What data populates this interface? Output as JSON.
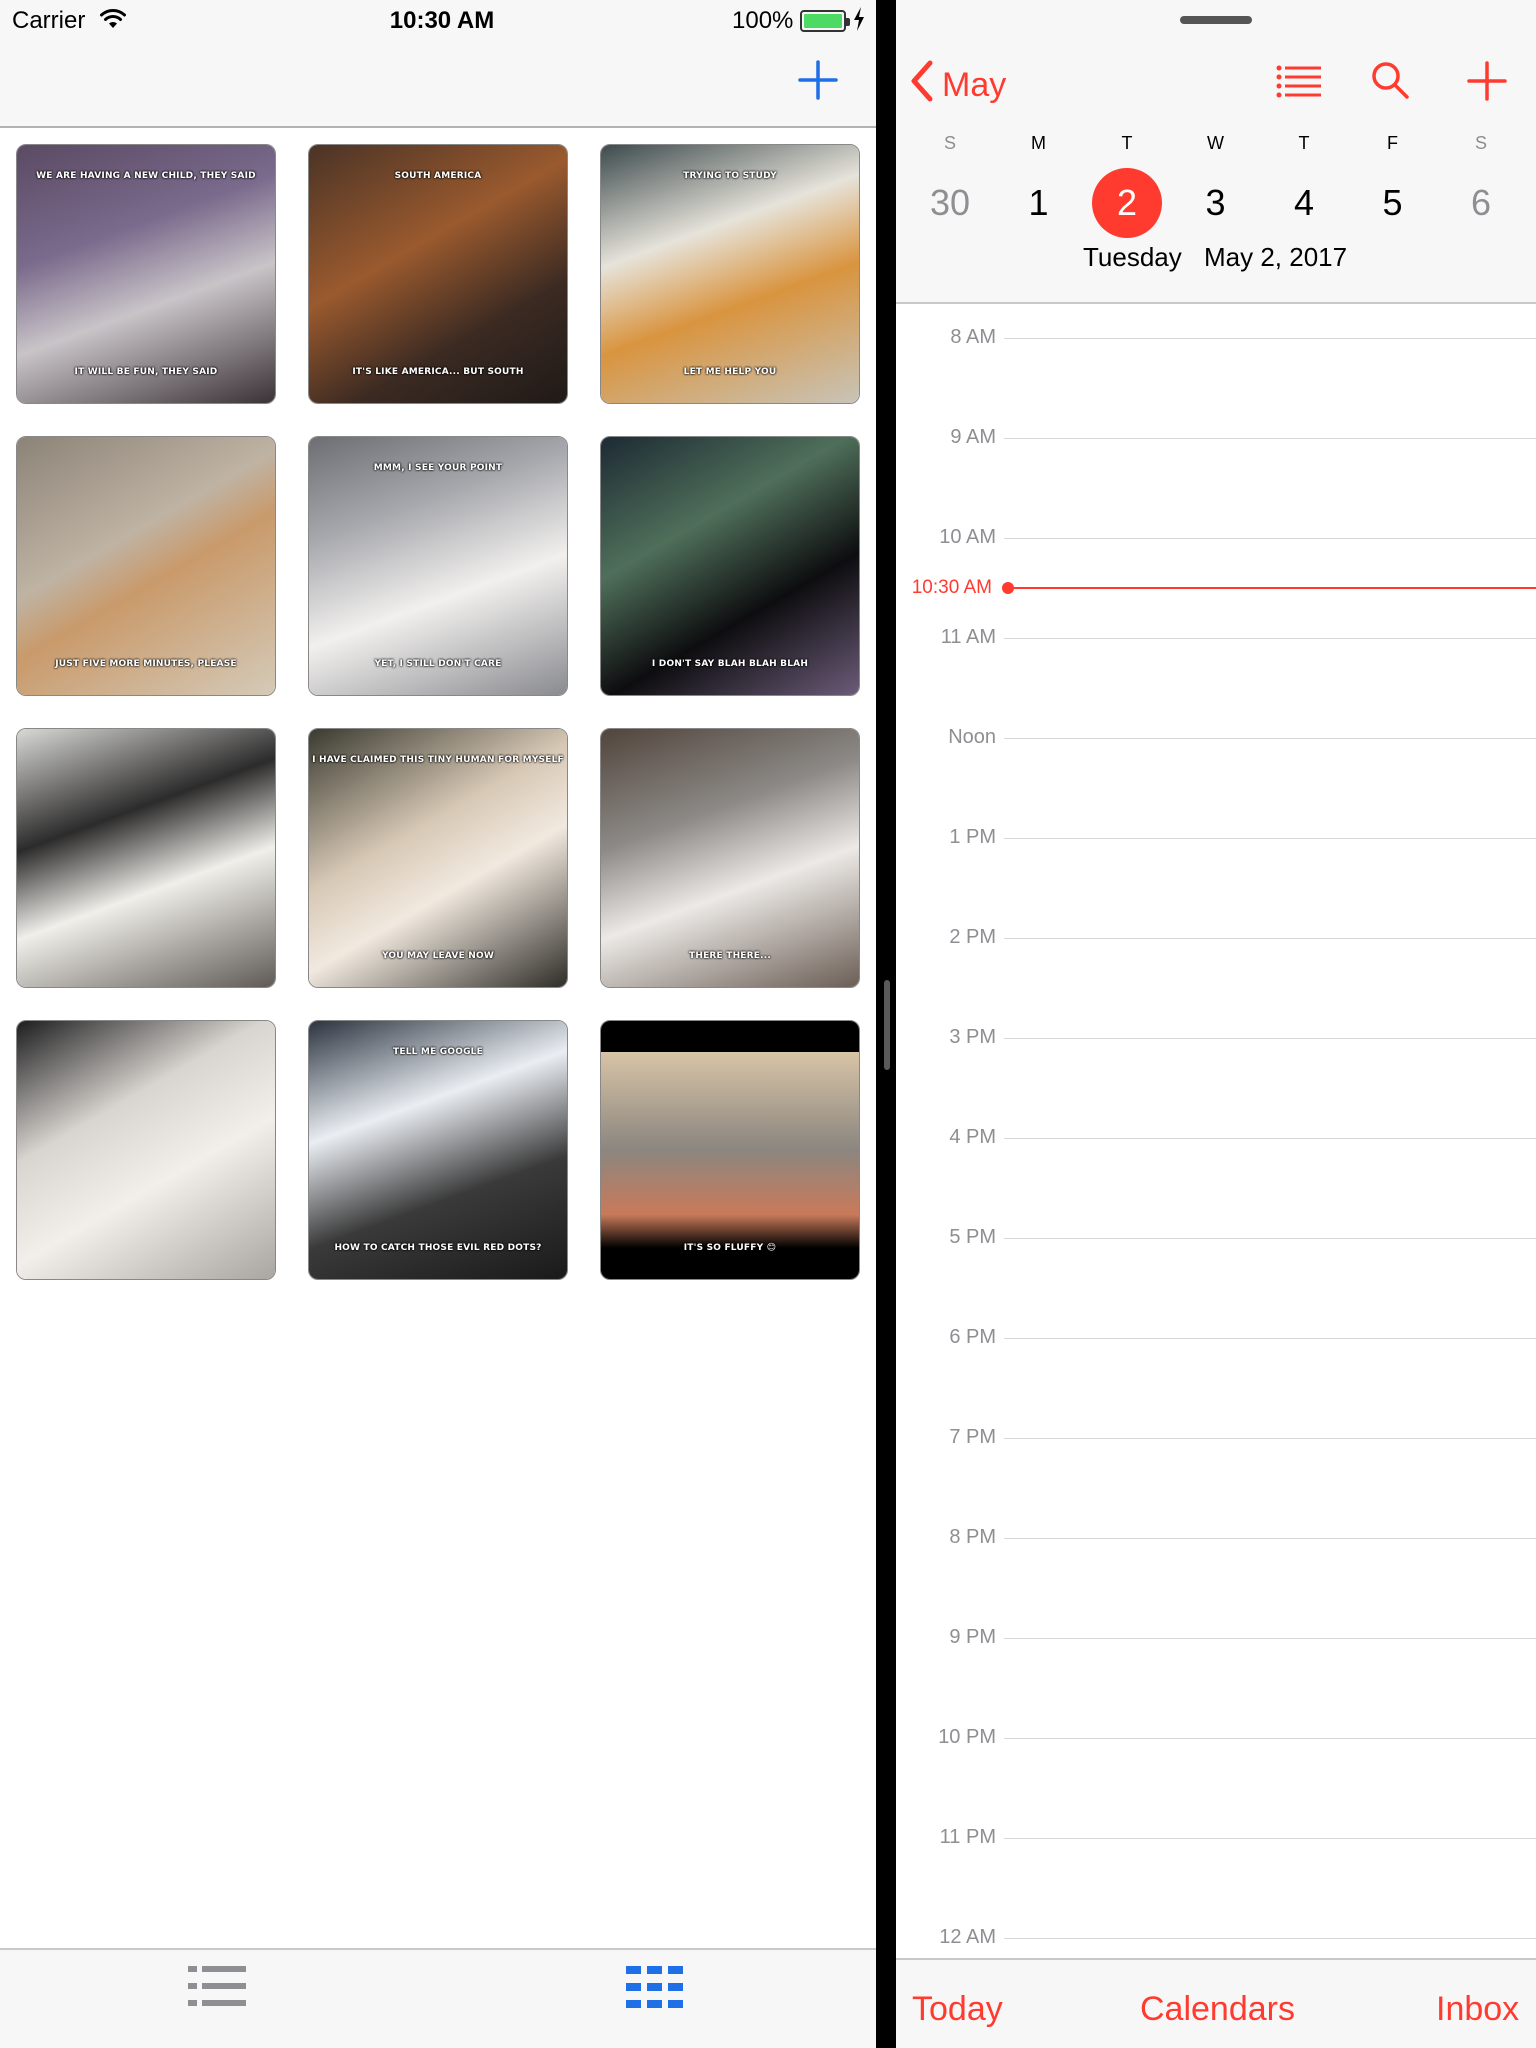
{
  "status_bar": {
    "carrier": "Carrier",
    "time": "10:30 AM",
    "battery_percent": "100%",
    "battery_level": 1.0,
    "wifi_icon": "wifi-icon",
    "charging_icon": "bolt-icon"
  },
  "left_app": {
    "add_icon": "plus-icon",
    "accent_color": "#1f6fe6",
    "tiles": [
      {
        "top": "WE ARE HAVING A NEW CHILD, THEY SAID",
        "bottom": "IT WILL BE FUN, THEY SAID"
      },
      {
        "top": "SOUTH AMERICA",
        "bottom": "IT'S LIKE AMERICA... BUT SOUTH"
      },
      {
        "top": "TRYING TO STUDY",
        "bottom": "LET ME HELP YOU"
      },
      {
        "top": "",
        "bottom": "JUST FIVE MORE MINUTES, PLEASE"
      },
      {
        "top": "MMM, I SEE YOUR POINT",
        "bottom": "YET, I STILL DON'T CARE"
      },
      {
        "top": "",
        "bottom": "I DON'T SAY BLAH BLAH BLAH"
      },
      {
        "top": "",
        "bottom": ""
      },
      {
        "top": "I HAVE CLAIMED THIS TINY HUMAN FOR MYSELF",
        "bottom": "YOU MAY LEAVE NOW"
      },
      {
        "top": "",
        "bottom": "THERE THERE..."
      },
      {
        "top": "",
        "bottom": ""
      },
      {
        "top": "TELL ME GOOGLE",
        "bottom": "HOW TO CATCH THOSE EVIL RED DOTS?"
      },
      {
        "top": "",
        "bottom": "IT'S SO FLUFFY 😊"
      }
    ],
    "tabbar": {
      "list_icon": "list-icon",
      "grid_icon": "grid-icon",
      "selected": "grid"
    }
  },
  "calendar": {
    "accent_color": "#ff3b30",
    "back_label": "May",
    "toolbar_icons": [
      "list-icon",
      "search-icon",
      "plus-icon"
    ],
    "weekdays": [
      "S",
      "M",
      "T",
      "W",
      "T",
      "F",
      "S"
    ],
    "days": [
      "30",
      "1",
      "2",
      "3",
      "4",
      "5",
      "6"
    ],
    "selected_day_index": 2,
    "selected_weekday": "Tuesday",
    "selected_date": "May 2, 2017",
    "hours": [
      "8 AM",
      "9 AM",
      "10 AM",
      "11 AM",
      "Noon",
      "1 PM",
      "2 PM",
      "3 PM",
      "4 PM",
      "5 PM",
      "6 PM",
      "7 PM",
      "8 PM",
      "9 PM",
      "10 PM",
      "11 PM",
      "12 AM"
    ],
    "current_time": "10:30 AM",
    "tabs": [
      "Today",
      "Calendars",
      "Inbox"
    ]
  }
}
